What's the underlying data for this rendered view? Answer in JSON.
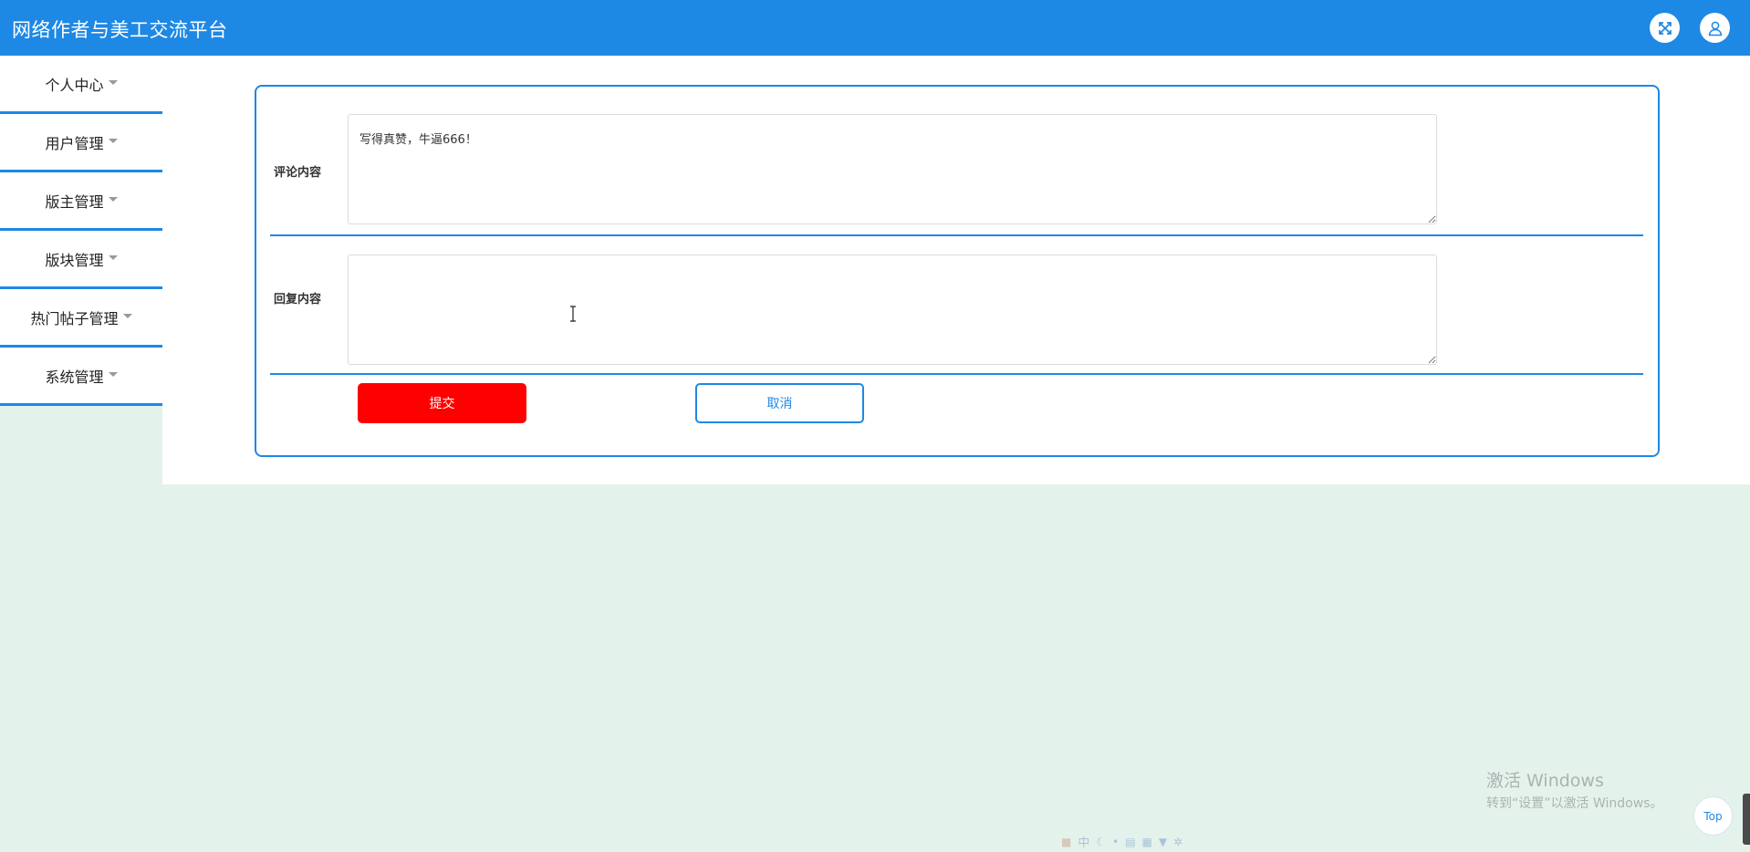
{
  "header": {
    "title": "网络作者与美工交流平台",
    "fullscreen_icon": "fullscreen-expand-icon",
    "user_icon": "user-icon",
    "accent_color": "#1e88e5"
  },
  "sidebar": {
    "items": [
      {
        "label": "个人中心"
      },
      {
        "label": "用户管理"
      },
      {
        "label": "版主管理"
      },
      {
        "label": "版块管理"
      },
      {
        "label": "热门帖子管理"
      },
      {
        "label": "系统管理"
      }
    ]
  },
  "form": {
    "comment_label": "评论内容",
    "comment_value": "写得真赞，牛逼666！",
    "reply_label": "回复内容",
    "reply_value": "",
    "submit_label": "提交",
    "submit_color": "#ff0000",
    "cancel_label": "取消"
  },
  "watermark": {
    "title": "激活 Windows",
    "subtitle": "转到“设置”以激活 Windows。"
  },
  "back_to_top": {
    "label": "Top"
  },
  "ime_toolbar": {
    "label": "中"
  }
}
